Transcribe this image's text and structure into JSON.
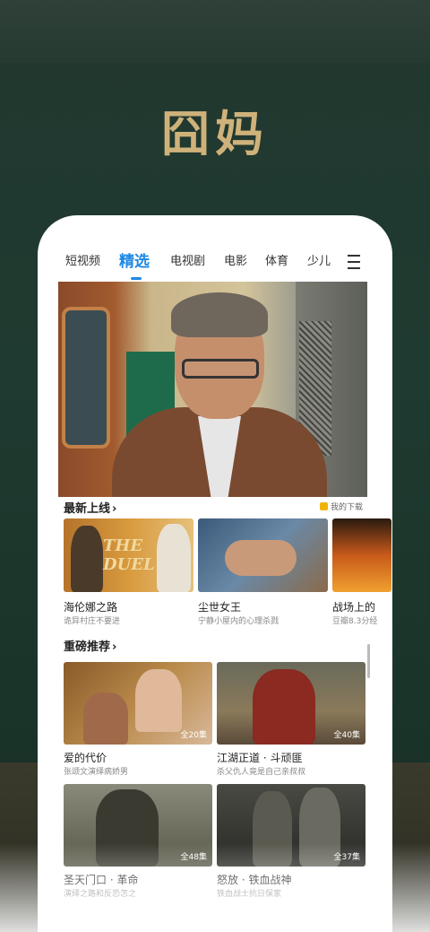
{
  "promo_title": "囧妈",
  "tabs": [
    {
      "label": "短视频"
    },
    {
      "label": "精选"
    },
    {
      "label": "电视剧"
    },
    {
      "label": "电影"
    },
    {
      "label": "体育"
    },
    {
      "label": "少儿"
    }
  ],
  "active_tab_index": 1,
  "accent_color": "#1e88e5",
  "sections": {
    "latest": {
      "title": "最新上线",
      "downloads_label": "我的下载",
      "items": [
        {
          "title": "海伦娜之路",
          "subtitle": "诡异村庄不要进",
          "poster_text": "THE DUEL"
        },
        {
          "title": "尘世女王",
          "subtitle": "宁静小屋内的心理杀戮"
        },
        {
          "title": "战场上的",
          "subtitle": "豆瓣8.3分经"
        }
      ]
    },
    "featured": {
      "title": "重磅推荐",
      "items": [
        {
          "title": "爱的代价",
          "subtitle": "张颂文演绎病娇男",
          "episodes": "全20集"
        },
        {
          "title": "江湖正道 · 斗顽匪",
          "subtitle": "杀父仇人竟是自己亲叔叔",
          "episodes": "全40集"
        },
        {
          "title": "圣天门口 · 革命",
          "subtitle": "演绎之路和反恐怎之",
          "episodes": "全48集"
        },
        {
          "title": "怒放 · 铁血战神",
          "subtitle": "铁血战士抗日保家",
          "episodes": "全37集"
        }
      ]
    }
  }
}
